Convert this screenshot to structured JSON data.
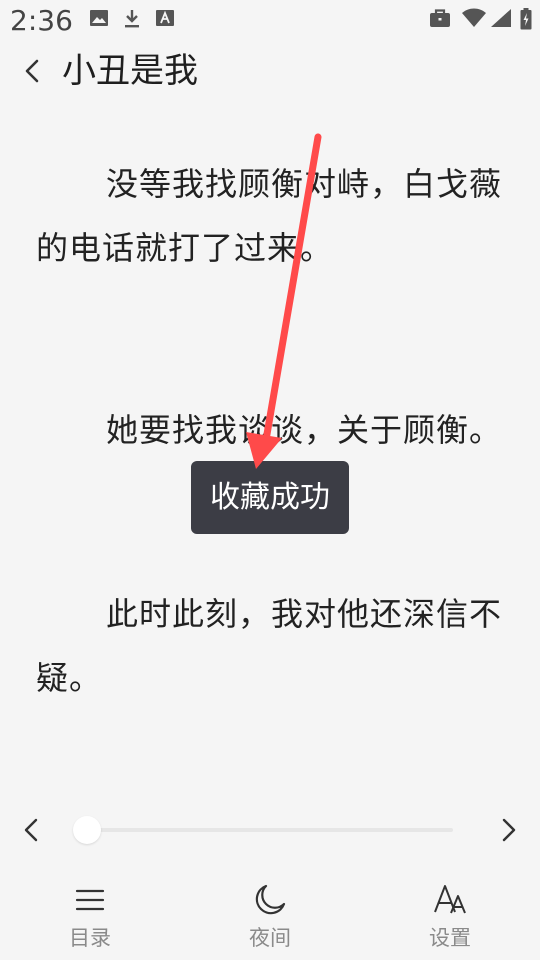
{
  "status_bar": {
    "time": "2:36",
    "icons": [
      "image-icon",
      "download-icon",
      "font-a-icon",
      "briefcase-icon",
      "wifi-icon",
      "signal-icon",
      "battery-icon"
    ]
  },
  "header": {
    "title": "小丑是我",
    "back_icon": "chevron-left-icon"
  },
  "content": {
    "paragraphs": [
      "没等我找顾衡对峙，白戈薇的电话就打了过来。",
      "她要找我谈谈，关于顾衡。",
      "此时此刻，我对他还深信不疑。"
    ]
  },
  "toast": {
    "text": "收藏成功"
  },
  "progress": {
    "value": 0.0
  },
  "bottom_nav": {
    "items": [
      {
        "label": "目录",
        "icon": "menu-list-icon"
      },
      {
        "label": "夜间",
        "icon": "moon-icon"
      },
      {
        "label": "设置",
        "icon": "font-settings-icon"
      }
    ]
  },
  "colors": {
    "background": "#f5f5f5",
    "toast_bg": "#3c3d45",
    "arrow": "#ff4a4a",
    "nav_label": "#8a8a8a"
  }
}
